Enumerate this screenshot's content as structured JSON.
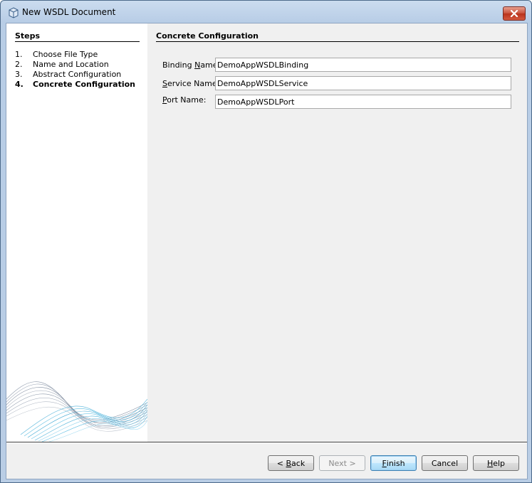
{
  "window": {
    "title": "New WSDL Document",
    "icons": {
      "app": "wsdl-document-icon",
      "close": "close-icon"
    }
  },
  "steps": {
    "heading": "Steps",
    "items": [
      {
        "num": "1.",
        "label": "Choose File Type",
        "current": false
      },
      {
        "num": "2.",
        "label": "Name and Location",
        "current": false
      },
      {
        "num": "3.",
        "label": "Abstract Configuration",
        "current": false
      },
      {
        "num": "4.",
        "label": "Concrete Configuration",
        "current": true
      }
    ]
  },
  "content": {
    "heading": "Concrete Configuration",
    "fields": {
      "binding": {
        "label_pre": "Binding ",
        "label_mnemonic": "N",
        "label_post": "ame:",
        "value": "DemoAppWSDLBinding"
      },
      "service": {
        "label_pre": "",
        "label_mnemonic": "S",
        "label_post": "ervice Name:",
        "value": "DemoAppWSDLService"
      },
      "port": {
        "label_pre": "",
        "label_mnemonic": "P",
        "label_post": "ort Name:",
        "value": "DemoAppWSDLPort"
      }
    }
  },
  "buttons": {
    "back": {
      "pre": "< ",
      "mnemonic": "B",
      "post": "ack"
    },
    "next": {
      "pre": "",
      "mnemonic": "",
      "post": "Next >"
    },
    "finish": {
      "pre": "",
      "mnemonic": "F",
      "post": "inish"
    },
    "cancel": {
      "pre": "",
      "mnemonic": "",
      "post": "Cancel"
    },
    "help": {
      "pre": "",
      "mnemonic": "H",
      "post": "elp"
    }
  },
  "colors": {
    "titlebar": "#b9cde5",
    "panel_bg": "#f0f0f0",
    "wave_blue": "#4fb2d9",
    "close_red": "#c8503a"
  }
}
